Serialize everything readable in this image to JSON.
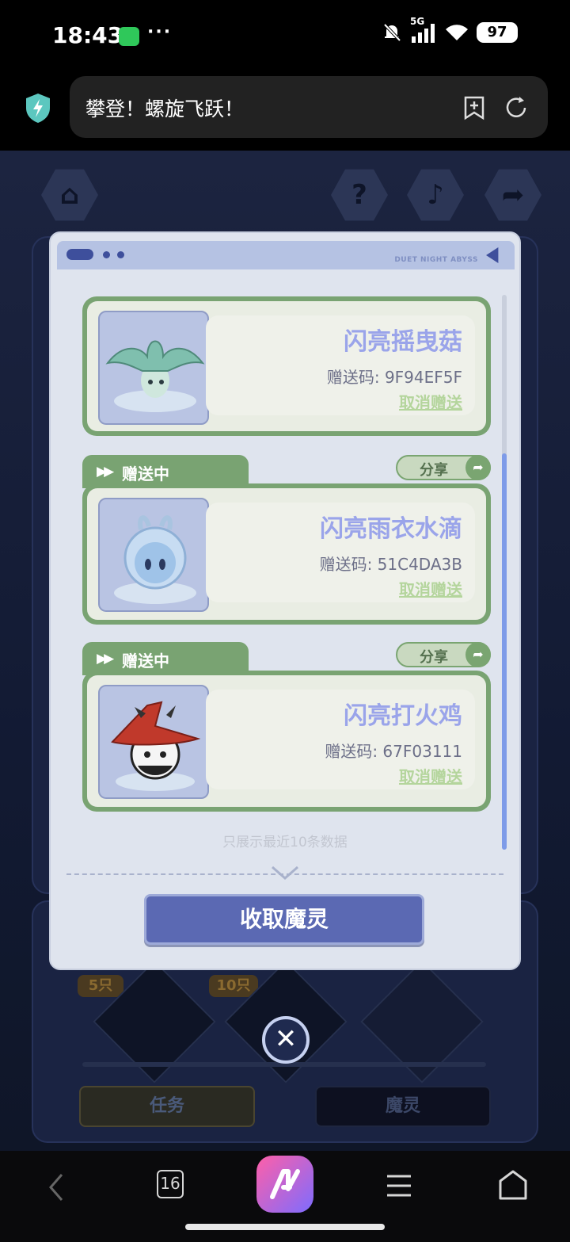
{
  "status_bar": {
    "time": "18:43",
    "dots": "···",
    "network": "5G",
    "battery": "97"
  },
  "browser": {
    "page_title": "攀登！螺旋飞跃！"
  },
  "modal": {
    "brand": "DUET NIGHT ABYSS",
    "items": [
      {
        "tab_label": "",
        "share_label": "",
        "name": "闪亮摇曳菇",
        "code": "赠送码: 9F94EF5F",
        "cancel_label": "取消赠送",
        "color": "#7fbfae"
      },
      {
        "tab_label": "赠送中",
        "share_label": "分享",
        "name": "闪亮雨衣水滴",
        "code": "赠送码: 51C4DA3B",
        "cancel_label": "取消赠送",
        "color": "#a9cbe9"
      },
      {
        "tab_label": "赠送中",
        "share_label": "分享",
        "name": "闪亮打火鸡",
        "code": "赠送码: 67F03111",
        "cancel_label": "取消赠送",
        "color": "#c0392b"
      }
    ],
    "footnote": "只展示最近10条数据",
    "collect_button": "收取魔灵"
  },
  "background": {
    "badge_5": "5只",
    "badge_10": "10只",
    "btn_task": "任务",
    "btn_spirit": "魔灵"
  },
  "bottom_nav": {
    "tabs_count": "16"
  }
}
